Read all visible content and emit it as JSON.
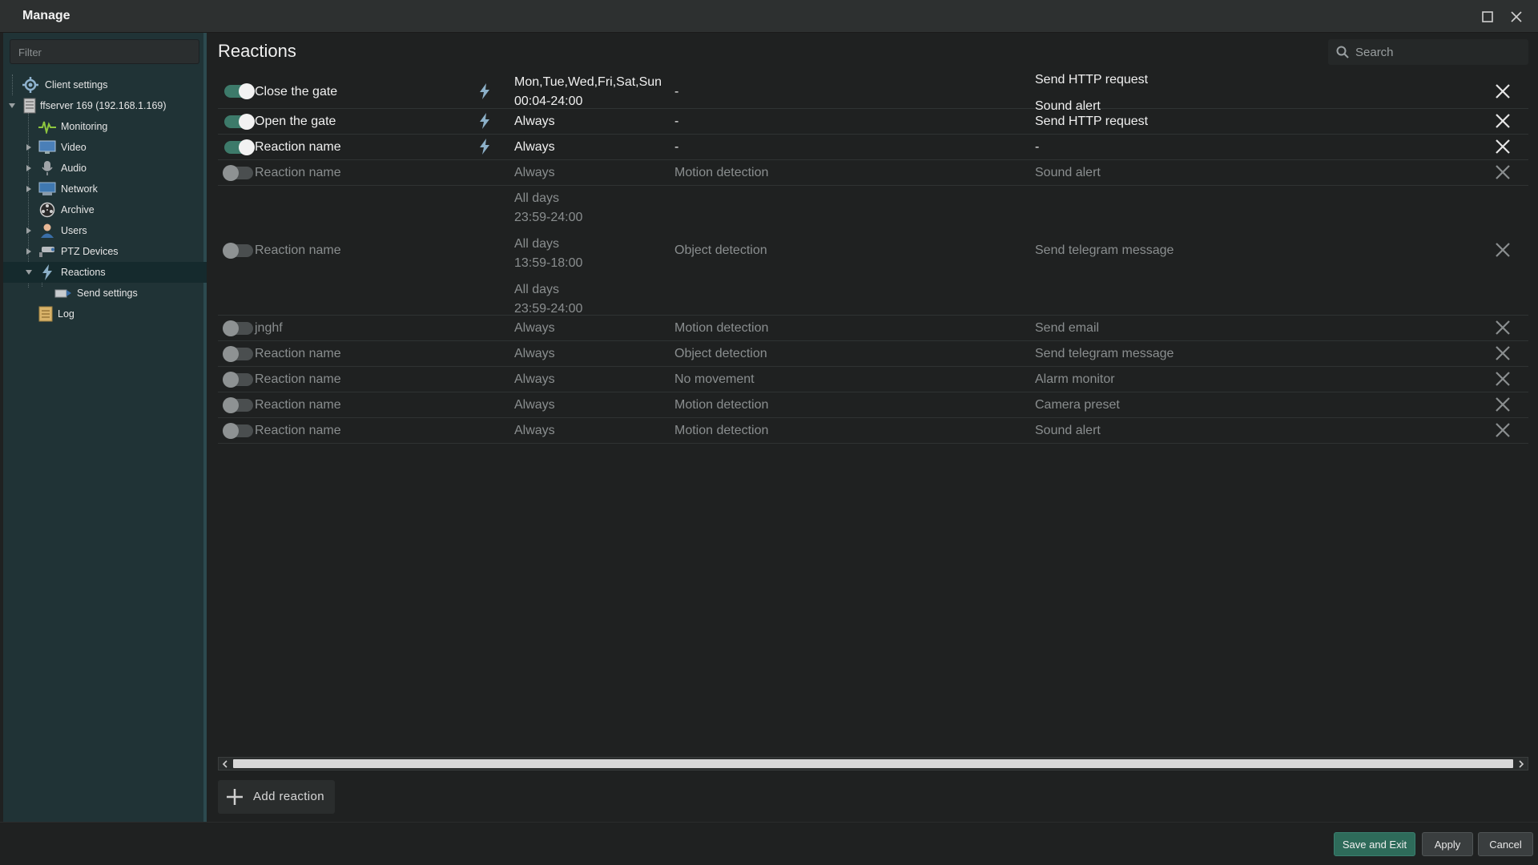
{
  "window": {
    "title": "Manage"
  },
  "sidebar": {
    "filter_placeholder": "Filter",
    "tree": [
      {
        "label": "Client settings",
        "icon": "gear-icon"
      },
      {
        "label": "ffserver 169 (192.168.1.169)",
        "icon": "server-icon"
      },
      {
        "label": "Monitoring",
        "icon": "monitoring-icon"
      },
      {
        "label": "Video",
        "icon": "monitor-icon"
      },
      {
        "label": "Audio",
        "icon": "microphone-icon"
      },
      {
        "label": "Network",
        "icon": "network-icon"
      },
      {
        "label": "Archive",
        "icon": "archive-icon"
      },
      {
        "label": "Users",
        "icon": "users-icon"
      },
      {
        "label": "PTZ Devices",
        "icon": "ptz-camera-icon"
      },
      {
        "label": "Reactions",
        "icon": "lightning-icon"
      },
      {
        "label": "Send settings",
        "icon": "send-icon"
      },
      {
        "label": "Log",
        "icon": "log-icon"
      }
    ]
  },
  "main": {
    "title": "Reactions",
    "search_placeholder": "Search",
    "reactions": [
      {
        "enabled": true,
        "name": "Close the gate",
        "schedule": [
          "Mon,Tue,Wed,Fri,Sat,Sun",
          "00:04-24:00"
        ],
        "trigger": "-",
        "actions": [
          "Send HTTP request",
          "Sound alert"
        ]
      },
      {
        "enabled": true,
        "name": "Open the gate",
        "schedule": [
          "Always"
        ],
        "trigger": "-",
        "actions": [
          "Send HTTP request"
        ]
      },
      {
        "enabled": true,
        "name": "Reaction name",
        "schedule": [
          "Always"
        ],
        "trigger": "-",
        "actions": [
          "-"
        ]
      },
      {
        "enabled": false,
        "name": "Reaction name",
        "schedule": [
          "Always"
        ],
        "trigger": "Motion detection",
        "actions": [
          "Sound alert"
        ]
      },
      {
        "enabled": false,
        "name": "Reaction name",
        "schedule": [
          "All days",
          "23:59-24:00",
          "All days",
          "13:59-18:00",
          "All days",
          "23:59-24:00"
        ],
        "trigger": "Object detection",
        "actions": [
          "Send telegram message"
        ]
      },
      {
        "enabled": false,
        "name": "jnghf",
        "schedule": [
          "Always"
        ],
        "trigger": "Motion detection",
        "actions": [
          "Send email"
        ]
      },
      {
        "enabled": false,
        "name": "Reaction name",
        "schedule": [
          "Always"
        ],
        "trigger": "Object detection",
        "actions": [
          "Send telegram message"
        ]
      },
      {
        "enabled": false,
        "name": "Reaction name",
        "schedule": [
          "Always"
        ],
        "trigger": "No movement",
        "actions": [
          "Alarm monitor"
        ]
      },
      {
        "enabled": false,
        "name": "Reaction name",
        "schedule": [
          "Always"
        ],
        "trigger": "Motion detection",
        "actions": [
          "Camera preset"
        ]
      },
      {
        "enabled": false,
        "name": "Reaction name",
        "schedule": [
          "Always"
        ],
        "trigger": "Motion detection",
        "actions": [
          "Sound alert"
        ]
      }
    ],
    "add_label": "Add reaction"
  },
  "footer": {
    "save_exit": "Save and Exit",
    "apply": "Apply",
    "cancel": "Cancel"
  },
  "colors": {
    "accent": "#2e6b5a",
    "toggle_on": "#3d7a6a",
    "sidebar_bg": "#203336"
  }
}
